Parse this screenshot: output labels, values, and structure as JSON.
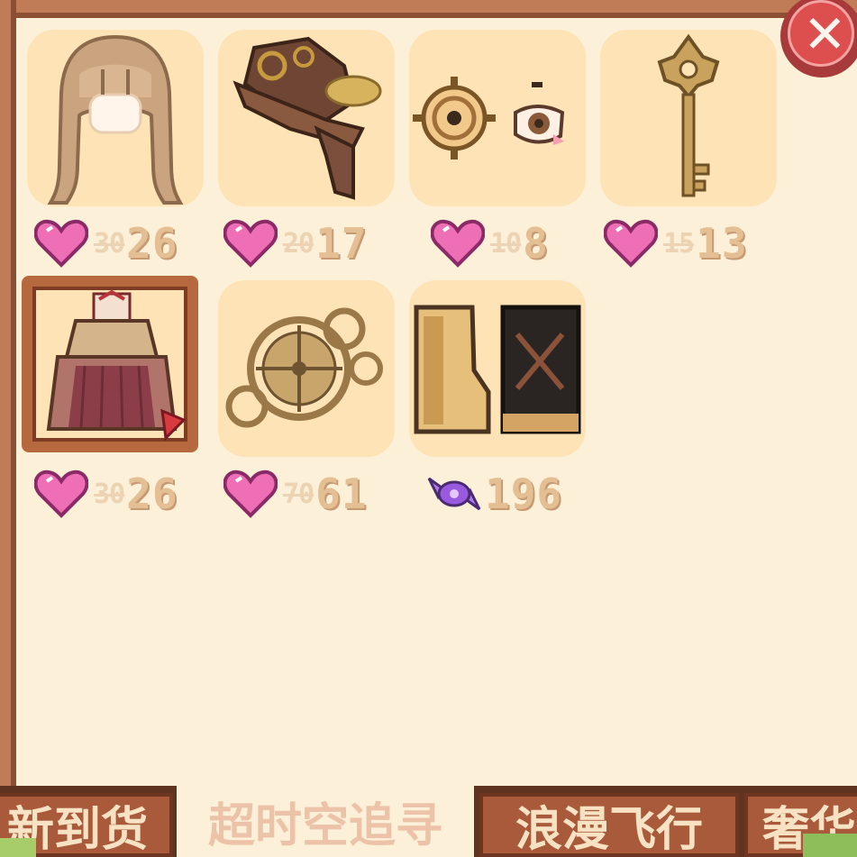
{
  "items": [
    {
      "name": "hair",
      "icon": "brown-long-hair-icon",
      "currency": "heart",
      "old_price": "30",
      "new_price": "26"
    },
    {
      "name": "hat",
      "icon": "steampunk-hat-icon",
      "currency": "heart",
      "old_price": "20",
      "new_price": "17"
    },
    {
      "name": "eye-accessory",
      "icon": "gear-eye-icon",
      "currency": "heart",
      "old_price": "10",
      "new_price": "8"
    },
    {
      "name": "key",
      "icon": "golden-key-icon",
      "currency": "heart",
      "old_price": "15",
      "new_price": "13"
    },
    {
      "name": "dress",
      "icon": "steampunk-dress-icon",
      "currency": "heart",
      "old_price": "30",
      "new_price": "26",
      "selected": true
    },
    {
      "name": "background",
      "icon": "clockwork-gears-icon",
      "currency": "heart",
      "old_price": "70",
      "new_price": "61"
    },
    {
      "name": "boots",
      "icon": "boots-icon",
      "currency": "candy",
      "old_price": "",
      "new_price": "196"
    }
  ],
  "tabs": [
    {
      "label": "新到货",
      "active": false
    },
    {
      "label": "超时空追寻",
      "active": true
    },
    {
      "label": "浪漫飞行",
      "active": false
    },
    {
      "label": "奢华",
      "active": false
    }
  ],
  "close_icon": "close-icon",
  "colors": {
    "panel": "#fdf0d8",
    "frame": "#c07c56",
    "tab": "#a85a3b",
    "heart": "#ef6fb6",
    "price": "#e4bf94"
  }
}
